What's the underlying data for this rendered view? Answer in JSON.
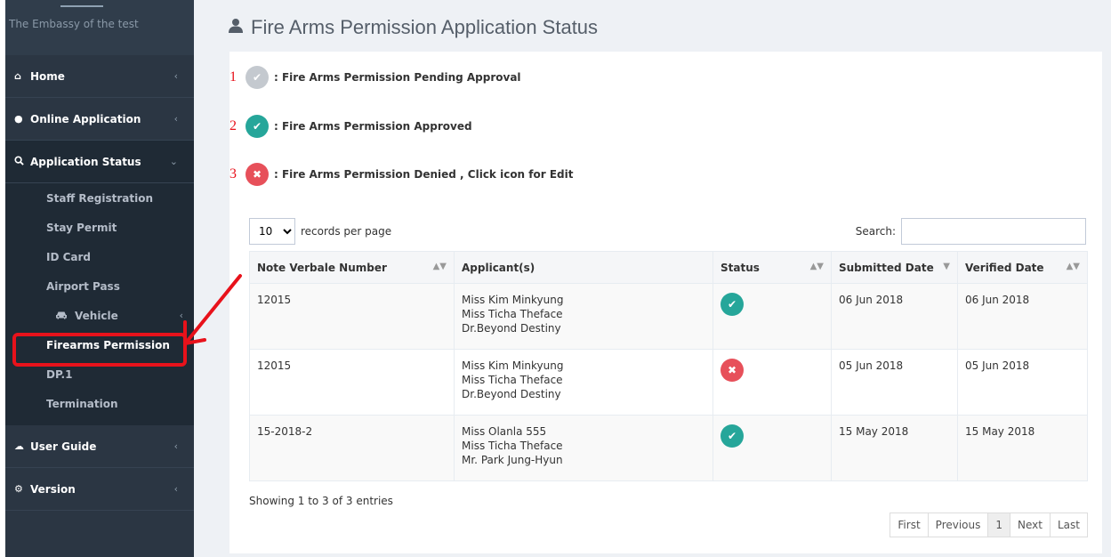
{
  "sidebar": {
    "brand": "The Embassy of the test",
    "items": [
      {
        "label": "Home"
      },
      {
        "label": "Online Application"
      },
      {
        "label": "Application Status"
      },
      {
        "label": "User Guide"
      },
      {
        "label": "Version"
      }
    ],
    "sub_items": [
      {
        "label": "Staff Registration"
      },
      {
        "label": "Stay Permit"
      },
      {
        "label": "ID Card"
      },
      {
        "label": "Airport Pass"
      },
      {
        "label": "Vehicle"
      },
      {
        "label": "Firearms Permission"
      },
      {
        "label": "DP.1"
      },
      {
        "label": "Termination"
      }
    ]
  },
  "main": {
    "title": "Fire Arms Permission Application Status",
    "legend": [
      {
        "num": "1",
        "text": ": Fire Arms Permission Pending Approval"
      },
      {
        "num": "2",
        "text": ": Fire Arms Permission Approved"
      },
      {
        "num": "3",
        "text": ": Fire Arms Permission Denied , Click icon for Edit"
      }
    ],
    "length_value": "10",
    "length_label": "records per page",
    "search_label": "Search:",
    "columns": [
      "Note Verbale Number",
      "Applicant(s)",
      "Status",
      "Submitted Date",
      "Verified Date"
    ],
    "rows": [
      {
        "number": "12015",
        "a1": "Miss Kim Minkyung",
        "a2": "Miss Ticha Theface",
        "a3": "Dr.Beyond Destiny",
        "status": "approved",
        "submitted": "06 Jun 2018",
        "verified": "06 Jun 2018"
      },
      {
        "number": "12015",
        "a1": "Miss Kim Minkyung",
        "a2": "Miss Ticha Theface",
        "a3": "Dr.Beyond Destiny",
        "status": "denied",
        "submitted": "05 Jun 2018",
        "verified": "05 Jun 2018"
      },
      {
        "number": "15-2018-2",
        "a1": "Miss Olanla 555",
        "a2": "Miss Ticha Theface",
        "a3": "Mr. Park Jung-Hyun",
        "status": "approved",
        "submitted": "15 May 2018",
        "verified": "15 May 2018"
      }
    ],
    "info": "Showing 1 to 3 of 3 entries",
    "pager": {
      "first": "First",
      "previous": "Previous",
      "current": "1",
      "next": "Next",
      "last": "Last"
    }
  },
  "colors": {
    "approved": "#26a69a",
    "denied": "#e7505a",
    "pending": "#c4c9cf",
    "annotation": "#e8121b"
  },
  "icons": [
    "home-icon",
    "user-icon",
    "search-icon",
    "car-icon",
    "cloud-icon",
    "gears-icon",
    "check-icon",
    "times-icon"
  ]
}
